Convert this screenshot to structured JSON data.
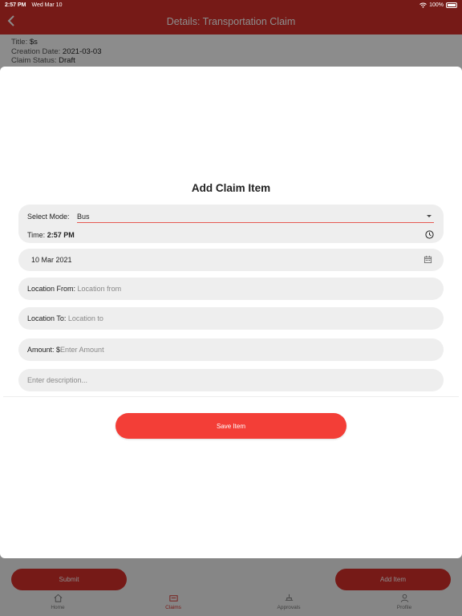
{
  "status_bar": {
    "time": "2:57 PM",
    "date": "Wed Mar 10",
    "battery": "100%"
  },
  "header": {
    "title": "Details: Transportation Claim",
    "back_icon": "chevron-left-icon"
  },
  "claim_info": {
    "title_label": "Title:",
    "title_value": "$s",
    "creation_label": "Creation Date:",
    "creation_value": "2021-03-03",
    "status_label": "Claim Status:",
    "status_value": "Draft"
  },
  "modal": {
    "title": "Add Claim Item",
    "mode_label": "Select Mode:",
    "mode_value": "Bus",
    "time_label": "Time:",
    "time_value": "2:57 PM",
    "date_value": "10 Mar 2021",
    "location_from_label": "Location From:",
    "location_from_placeholder": "Location from",
    "location_to_label": "Location To:",
    "location_to_placeholder": "Location to",
    "amount_label": "Amount: $",
    "amount_placeholder": "Enter Amount",
    "description_placeholder": "Enter description...",
    "save_label": "Save Item"
  },
  "bottom": {
    "submit_label": "Submit",
    "add_item_label": "Add Item",
    "tabs": [
      {
        "label": "Home",
        "icon": "home-icon"
      },
      {
        "label": "Claims",
        "icon": "claims-icon",
        "active": true
      },
      {
        "label": "Approvals",
        "icon": "approvals-icon"
      },
      {
        "label": "Profile",
        "icon": "profile-icon"
      }
    ]
  },
  "colors": {
    "accent": "#d8302a",
    "save_button": "#f33e37",
    "field_bg": "#eeeeee"
  }
}
